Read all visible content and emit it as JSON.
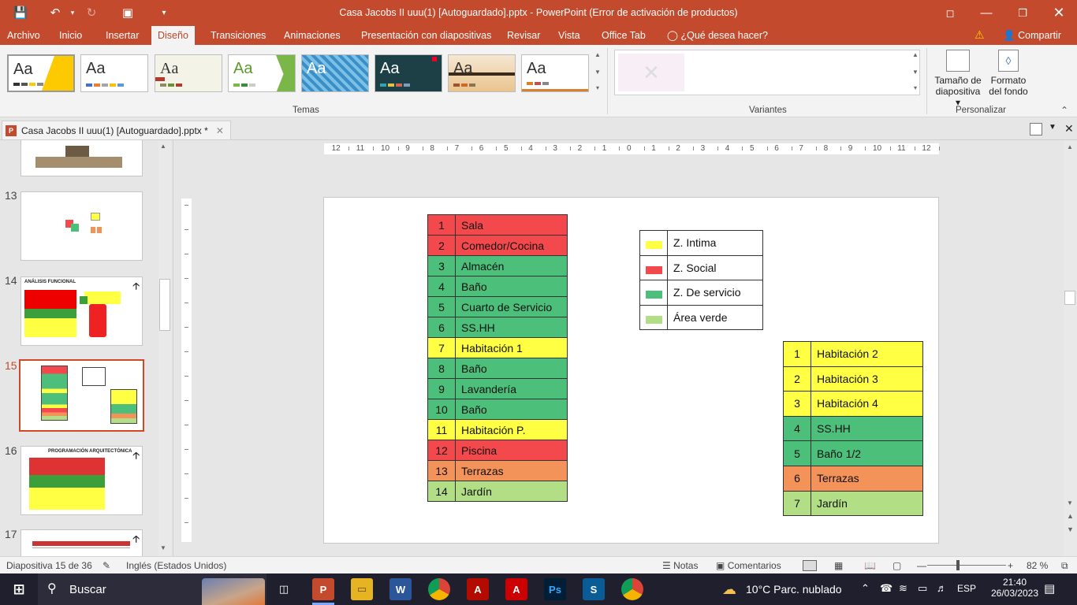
{
  "window": {
    "title": "Casa Jacobs II uuu(1) [Autoguardado].pptx - PowerPoint (Error de activación de productos)"
  },
  "menu": {
    "tabs": [
      "Archivo",
      "Inicio",
      "Insertar",
      "Diseño",
      "Transiciones",
      "Animaciones",
      "Presentación con diapositivas",
      "Revisar",
      "Vista",
      "Office Tab"
    ],
    "active": "Diseño",
    "tell_me": "¿Qué desea hacer?",
    "share": "Compartir"
  },
  "ribbon": {
    "themes_label": "Temas",
    "variants_label": "Variantes",
    "customize_label": "Personalizar",
    "theme_text": "Aa",
    "slide_size": {
      "line1": "Tamaño de",
      "line2": "diapositiva ▾"
    },
    "format_bg": {
      "line1": "Formato",
      "line2": "del fondo"
    }
  },
  "doc_tab": {
    "label": "Casa Jacobs II uuu(1) [Autoguardado].pptx *"
  },
  "thumbnails": {
    "numbers": [
      "13",
      "14",
      "15",
      "16",
      "17"
    ],
    "selected": "15"
  },
  "slide": {
    "table1": [
      {
        "n": "1",
        "label": "Sala",
        "color": "#f4494c"
      },
      {
        "n": "2",
        "label": "Comedor/Cocina",
        "color": "#f4494c"
      },
      {
        "n": "3",
        "label": "Almacén",
        "color": "#4cbf7a"
      },
      {
        "n": "4",
        "label": "Baño",
        "color": "#4cbf7a"
      },
      {
        "n": "5",
        "label": "Cuarto de Servicio",
        "color": "#4cbf7a"
      },
      {
        "n": "6",
        "label": "SS.HH",
        "color": "#4cbf7a"
      },
      {
        "n": "7",
        "label": "Habitación 1",
        "color": "#ffff44"
      },
      {
        "n": "8",
        "label": "Baño",
        "color": "#4cbf7a"
      },
      {
        "n": "9",
        "label": "Lavandería",
        "color": "#4cbf7a"
      },
      {
        "n": "10",
        "label": "Baño",
        "color": "#4cbf7a"
      },
      {
        "n": "11",
        "label": "Habitación P.",
        "color": "#ffff44"
      },
      {
        "n": "12",
        "label": "Piscina",
        "color": "#f4494c"
      },
      {
        "n": "13",
        "label": "Terrazas",
        "color": "#f3935a"
      },
      {
        "n": "14",
        "label": "Jardín",
        "color": "#b2df86"
      }
    ],
    "legend": [
      {
        "label": "Z. Intima",
        "color": "#ffff44"
      },
      {
        "label": "Z. Social",
        "color": "#f4494c"
      },
      {
        "label": "Z. De servicio",
        "color": "#4cbf7a"
      },
      {
        "label": "Área verde",
        "color": "#b2df86"
      }
    ],
    "table2": [
      {
        "n": "1",
        "label": "Habitación 2",
        "color": "#ffff44"
      },
      {
        "n": "2",
        "label": "Habitación 3",
        "color": "#ffff44"
      },
      {
        "n": "3",
        "label": "Habitación 4",
        "color": "#ffff44"
      },
      {
        "n": "4",
        "label": "SS.HH",
        "color": "#4cbf7a"
      },
      {
        "n": "5",
        "label": "Baño 1/2",
        "color": "#4cbf7a"
      },
      {
        "n": "6",
        "label": "Terrazas",
        "color": "#f3935a"
      },
      {
        "n": "7",
        "label": "Jardín",
        "color": "#b2df86"
      }
    ]
  },
  "ruler": {
    "h_ticks": [
      "12",
      "11",
      "10",
      "9",
      "8",
      "7",
      "6",
      "5",
      "4",
      "3",
      "2",
      "1",
      "0",
      "1",
      "2",
      "3",
      "4",
      "5",
      "6",
      "7",
      "8",
      "9",
      "10",
      "11",
      "12"
    ]
  },
  "status": {
    "slide_info": "Diapositiva 15 de 36",
    "language": "Inglés (Estados Unidos)",
    "notes": "Notas",
    "comments": "Comentarios",
    "zoom": "82 %"
  },
  "taskbar": {
    "search": "Buscar",
    "weather": "10°C  Parc. nublado",
    "lang": "ESP",
    "time": "21:40",
    "date": "26/03/2023"
  }
}
